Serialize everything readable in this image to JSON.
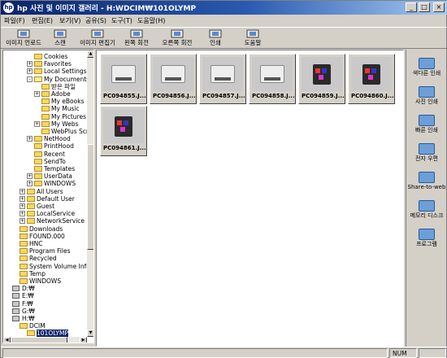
{
  "window": {
    "title": "hp 사진 및 이미지 갤러리 - H:WDCIM₩101OLYMP",
    "app_icon": "hp",
    "minimize": "_",
    "maximize": "□",
    "close": "×"
  },
  "menu": [
    "파일(F)",
    "편집(E)",
    "보기(V)",
    "공유(S)",
    "도구(T)",
    "도움말(H)"
  ],
  "toolbar": [
    {
      "label": "이미지 언로드",
      "icon": "unload-icon"
    },
    {
      "label": "스캔",
      "icon": "scan-icon"
    },
    {
      "label": "이미지 편집기",
      "icon": "image-editor-icon"
    },
    {
      "label": "왼쪽 회전",
      "icon": "rotate-left-icon"
    },
    {
      "label": "오른쪽 회전",
      "icon": "rotate-right-icon"
    },
    {
      "label": "인쇄",
      "icon": "print-icon"
    },
    {
      "label": "도움말",
      "icon": "help-icon"
    }
  ],
  "tree": [
    {
      "label": "Cookies",
      "indent": 3,
      "exp": ""
    },
    {
      "label": "Favorites",
      "indent": 3,
      "exp": "+"
    },
    {
      "label": "Local Settings",
      "indent": 3,
      "exp": "+"
    },
    {
      "label": "My Documents",
      "indent": 3,
      "exp": "-",
      "open": true
    },
    {
      "label": "받은 파일",
      "indent": 4,
      "exp": ""
    },
    {
      "label": "Adobe",
      "indent": 4,
      "exp": "+"
    },
    {
      "label": "My eBooks",
      "indent": 4,
      "exp": ""
    },
    {
      "label": "My Music",
      "indent": 4,
      "exp": ""
    },
    {
      "label": "My Pictures",
      "indent": 4,
      "exp": ""
    },
    {
      "label": "My Webs",
      "indent": 4,
      "exp": "+"
    },
    {
      "label": "WebPlus Scrap",
      "indent": 4,
      "exp": ""
    },
    {
      "label": "NetHood",
      "indent": 3,
      "exp": "+"
    },
    {
      "label": "PrintHood",
      "indent": 3,
      "exp": ""
    },
    {
      "label": "Recent",
      "indent": 3,
      "exp": ""
    },
    {
      "label": "SendTo",
      "indent": 3,
      "exp": ""
    },
    {
      "label": "Templates",
      "indent": 3,
      "exp": ""
    },
    {
      "label": "UserData",
      "indent": 3,
      "exp": "+"
    },
    {
      "label": "WINDOWS",
      "indent": 3,
      "exp": "+"
    },
    {
      "label": "All Users",
      "indent": 2,
      "exp": "+"
    },
    {
      "label": "Default User",
      "indent": 2,
      "exp": "+"
    },
    {
      "label": "Guest",
      "indent": 2,
      "exp": "+"
    },
    {
      "label": "LocalService",
      "indent": 2,
      "exp": "+"
    },
    {
      "label": "NetworkService",
      "indent": 2,
      "exp": "+"
    },
    {
      "label": "Downloads",
      "indent": 1,
      "exp": ""
    },
    {
      "label": "FOUND.000",
      "indent": 1,
      "exp": ""
    },
    {
      "label": "HNC",
      "indent": 1,
      "exp": ""
    },
    {
      "label": "Program Files",
      "indent": 1,
      "exp": ""
    },
    {
      "label": "Recycled",
      "indent": 1,
      "exp": ""
    },
    {
      "label": "System Volume Informatic",
      "indent": 1,
      "exp": ""
    },
    {
      "label": "Temp",
      "indent": 1,
      "exp": ""
    },
    {
      "label": "WINDOWS",
      "indent": 1,
      "exp": ""
    },
    {
      "label": "D:₩",
      "indent": 0,
      "exp": "",
      "drive": true
    },
    {
      "label": "E:₩",
      "indent": 0,
      "exp": "",
      "drive": true
    },
    {
      "label": "F:₩",
      "indent": 0,
      "exp": "",
      "drive": true
    },
    {
      "label": "G:₩",
      "indent": 0,
      "exp": "",
      "drive": true
    },
    {
      "label": "H:₩",
      "indent": 0,
      "exp": "",
      "drive": true
    },
    {
      "label": "DCIM",
      "indent": 1,
      "exp": ""
    },
    {
      "label": "101OLYMP",
      "indent": 2,
      "exp": "",
      "selected": true
    }
  ],
  "thumbnails": [
    {
      "name": "PC094855.J...",
      "kind": "printer"
    },
    {
      "name": "PC094856.J...",
      "kind": "printer"
    },
    {
      "name": "PC094857.J...",
      "kind": "printer"
    },
    {
      "name": "PC094858.J...",
      "kind": "printer"
    },
    {
      "name": "PC094859.J...",
      "kind": "cartridge"
    },
    {
      "name": "PC094860.J...",
      "kind": "cartridge"
    },
    {
      "name": "PC094861.J...",
      "kind": "cartridge"
    }
  ],
  "right_panel": [
    {
      "label": "색다른 인쇄",
      "icon": "creative-print-icon"
    },
    {
      "label": "사진 인쇄",
      "icon": "photo-print-icon"
    },
    {
      "label": "빠른 인쇄",
      "icon": "quick-print-icon"
    },
    {
      "label": "전자 우편",
      "icon": "email-icon"
    },
    {
      "label": "Share-to-web",
      "icon": "share-web-icon"
    },
    {
      "label": "메모리 디스크",
      "icon": "memory-disk-icon"
    },
    {
      "label": "프로그램",
      "icon": "programs-icon"
    }
  ],
  "status": {
    "num": "NUM"
  }
}
